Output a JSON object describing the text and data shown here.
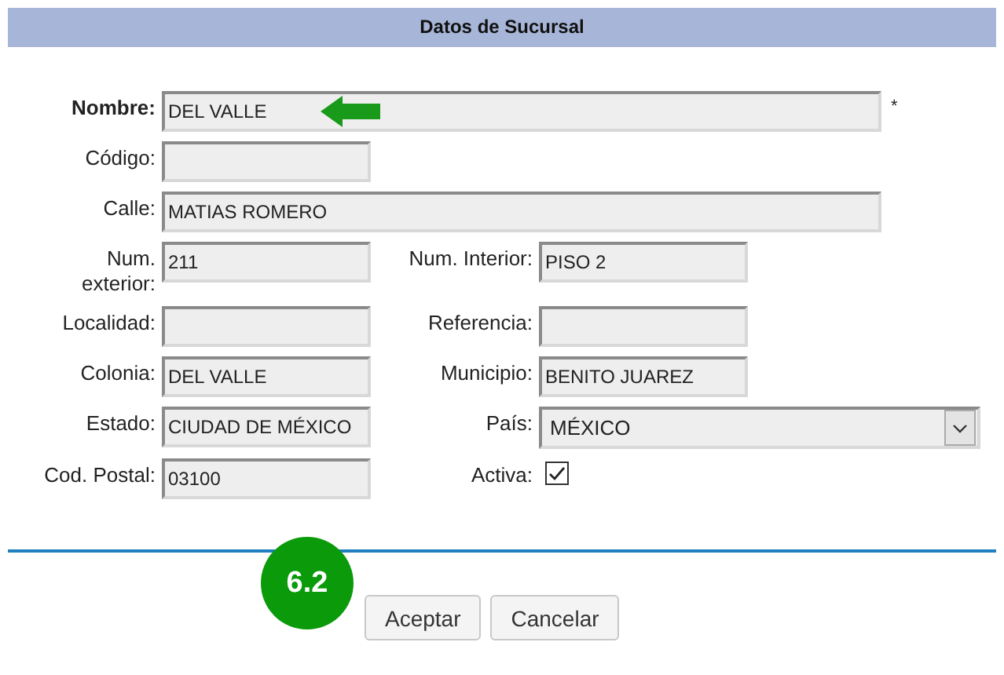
{
  "header": {
    "title": "Datos de Sucursal"
  },
  "rows": [
    {
      "fields": [
        {
          "kind": "wide",
          "label": "Nombre:",
          "emphasized": true,
          "value": "DEL VALLE",
          "pointer": true,
          "required_mark": "*"
        }
      ]
    },
    {
      "fields": [
        {
          "kind": "text",
          "label": "Código:",
          "emphasized": false
        }
      ]
    },
    {
      "fields": [
        {
          "kind": "wide",
          "label": "Calle:",
          "emphasized": false,
          "value": "MATIAS ROMERO"
        }
      ]
    },
    {
      "fields": [
        {
          "kind": "text",
          "label": "Num. exterior:",
          "emphasized": false,
          "value": "211"
        },
        {
          "kind": "text",
          "label": "Num. Interior:",
          "emphasized": false,
          "value": "PISO 2"
        }
      ]
    },
    {
      "fields": [
        {
          "kind": "text",
          "label": "Localidad:",
          "emphasized": false
        },
        {
          "kind": "text",
          "label": "Referencia:",
          "emphasized": false
        }
      ]
    },
    {
      "fields": [
        {
          "kind": "text",
          "label": "Colonia:",
          "emphasized": false,
          "value": "DEL VALLE"
        },
        {
          "kind": "text",
          "label": "Municipio:",
          "emphasized": false,
          "value": "BENITO JUAREZ"
        }
      ]
    },
    {
      "fields": [
        {
          "kind": "text",
          "label": "Estado:",
          "emphasized": false,
          "value": "CIUDAD DE MÉXICO"
        },
        {
          "kind": "select",
          "label": "País:",
          "emphasized": false,
          "value": "MÉXICO"
        }
      ]
    },
    {
      "fields": [
        {
          "kind": "text",
          "label": "Cod. Postal:",
          "emphasized": false,
          "value": "03100"
        },
        {
          "kind": "checkbox",
          "label": "Activa:",
          "emphasized": false,
          "checked": true
        }
      ]
    }
  ],
  "step_badge": "6.2",
  "buttons": [
    "Aceptar",
    "Cancelar"
  ]
}
